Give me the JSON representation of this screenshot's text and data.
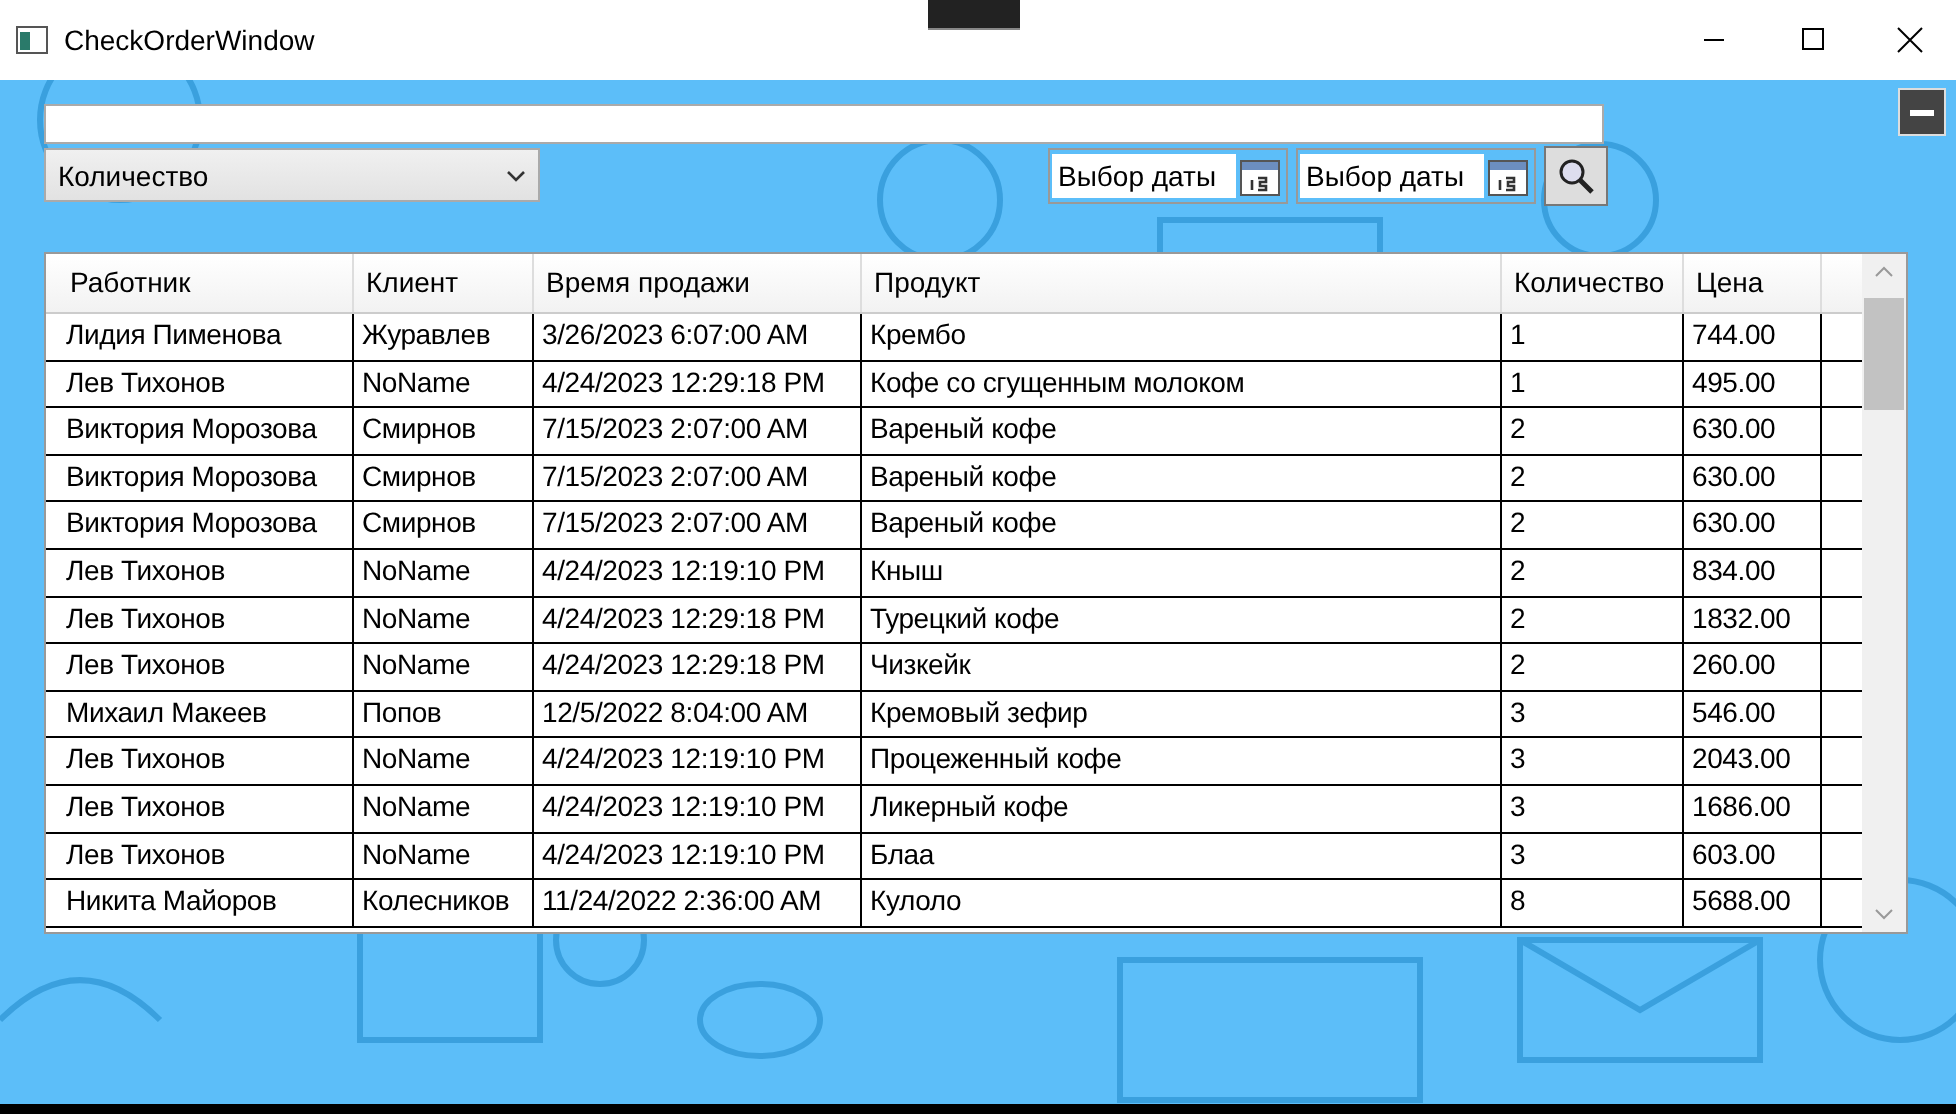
{
  "window": {
    "title": "CheckOrderWindow"
  },
  "sort_combo": {
    "value": "Количество"
  },
  "date_from": {
    "placeholder": "Выбор даты"
  },
  "date_to": {
    "placeholder": "Выбор даты"
  },
  "table": {
    "columns": [
      "Работник",
      "Клиент",
      "Время продажи",
      "Продукт",
      "Количество",
      "Цена"
    ],
    "rows": [
      [
        "Лидия Пименова",
        "Журавлев",
        "3/26/2023 6:07:00 AM",
        "Крембо",
        "1",
        "744.00"
      ],
      [
        "Лев Тихонов",
        "NoName",
        "4/24/2023 12:29:18 PM",
        "Кофе со сгущенным молоком",
        "1",
        "495.00"
      ],
      [
        "Виктория Морозова",
        "Смирнов",
        "7/15/2023 2:07:00 AM",
        "Вареный кофе",
        "2",
        "630.00"
      ],
      [
        "Виктория Морозова",
        "Смирнов",
        "7/15/2023 2:07:00 AM",
        "Вареный кофе",
        "2",
        "630.00"
      ],
      [
        "Виктория Морозова",
        "Смирнов",
        "7/15/2023 2:07:00 AM",
        "Вареный кофе",
        "2",
        "630.00"
      ],
      [
        "Лев Тихонов",
        "NoName",
        "4/24/2023 12:19:10 PM",
        "Кныш",
        "2",
        "834.00"
      ],
      [
        "Лев Тихонов",
        "NoName",
        "4/24/2023 12:29:18 PM",
        "Турецкий кофе",
        "2",
        "1832.00"
      ],
      [
        "Лев Тихонов",
        "NoName",
        "4/24/2023 12:29:18 PM",
        "Чизкейк",
        "2",
        "260.00"
      ],
      [
        "Михаил Макеев",
        "Попов",
        "12/5/2022 8:04:00 AM",
        "Кремовый зефир",
        "3",
        "546.00"
      ],
      [
        "Лев Тихонов",
        "NoName",
        "4/24/2023 12:19:10 PM",
        "Процеженный кофе",
        "3",
        "2043.00"
      ],
      [
        "Лев Тихонов",
        "NoName",
        "4/24/2023 12:19:10 PM",
        "Ликерный кофе",
        "3",
        "1686.00"
      ],
      [
        "Лев Тихонов",
        "NoName",
        "4/24/2023 12:19:10 PM",
        "Блаа",
        "3",
        "603.00"
      ],
      [
        "Никита Майоров",
        "Колесников",
        "11/24/2022 2:36:00 AM",
        "Кулоло",
        "8",
        "5688.00"
      ]
    ]
  }
}
